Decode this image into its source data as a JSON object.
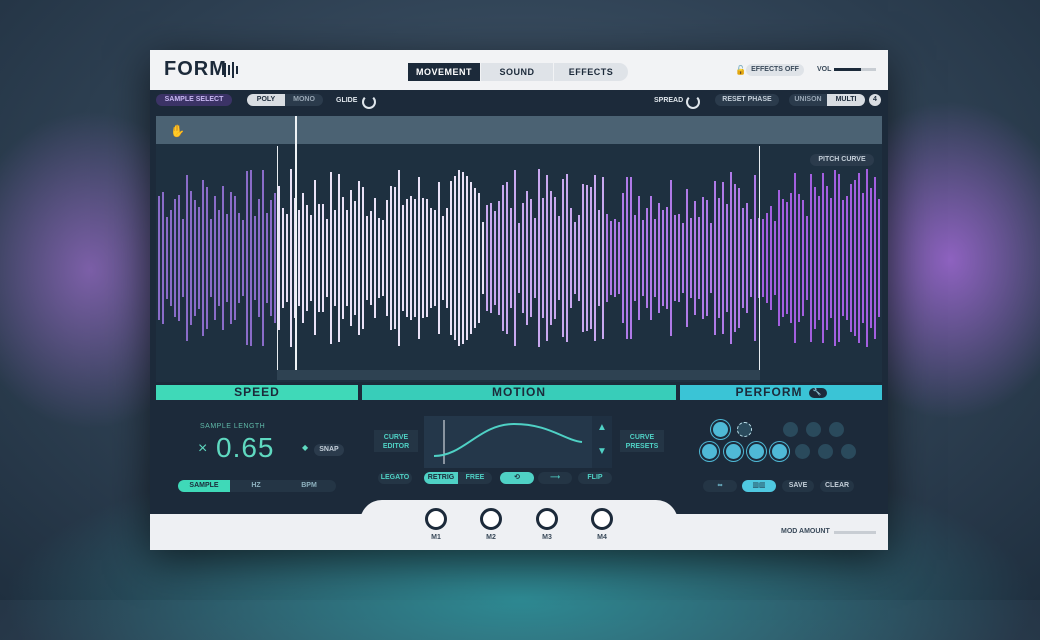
{
  "header": {
    "logo": "FORM",
    "tabs": [
      {
        "label": "MOVEMENT",
        "active": true
      },
      {
        "label": "SOUND",
        "active": false
      },
      {
        "label": "EFFECTS",
        "active": false
      }
    ],
    "effects_off_label": "EFFECTS OFF",
    "vol_label": "VOL",
    "vol_level": 0.65
  },
  "toprow": {
    "sample_select": "SAMPLE SELECT",
    "poly": "POLY",
    "mono": "MONO",
    "glide": "GLIDE",
    "spread": "SPREAD",
    "reset_phase": "RESET PHASE",
    "unison": "UNISON",
    "multi": "MULTI",
    "voices": "4"
  },
  "wave": {
    "pitch_curve": "PITCH CURVE"
  },
  "sections": {
    "speed": "SPEED",
    "motion": "MOTION",
    "perform": "PERFORM"
  },
  "speed": {
    "sample_length_label": "SAMPLE LENGTH",
    "multiplier": "×",
    "value": "0.65",
    "snap": "SNAP",
    "modes": [
      "SAMPLE",
      "HZ",
      "BPM"
    ]
  },
  "motion": {
    "curve_editor": "CURVE EDITOR",
    "curve_presets": "CURVE PRESETS",
    "legato": "LEGATO",
    "retrig": "RETRIG",
    "free": "FREE",
    "loop_icon": "loop-icon",
    "forward_icon": "arrow-right-icon",
    "flip": "FLIP"
  },
  "perform": {
    "save": "SAVE",
    "clear": "CLEAR"
  },
  "footer": {
    "macros": [
      "M1",
      "M2",
      "M3",
      "M4"
    ],
    "mod_amount": "MOD AMOUNT"
  },
  "colors": {
    "speed_accent": "#3fd9b8",
    "motion_accent": "#38cdb9",
    "perform_accent": "#3ac4d6",
    "wave_left": "#8a6cc9",
    "wave_selected": "#eae2f7",
    "wave_right": "#a45fe0"
  }
}
